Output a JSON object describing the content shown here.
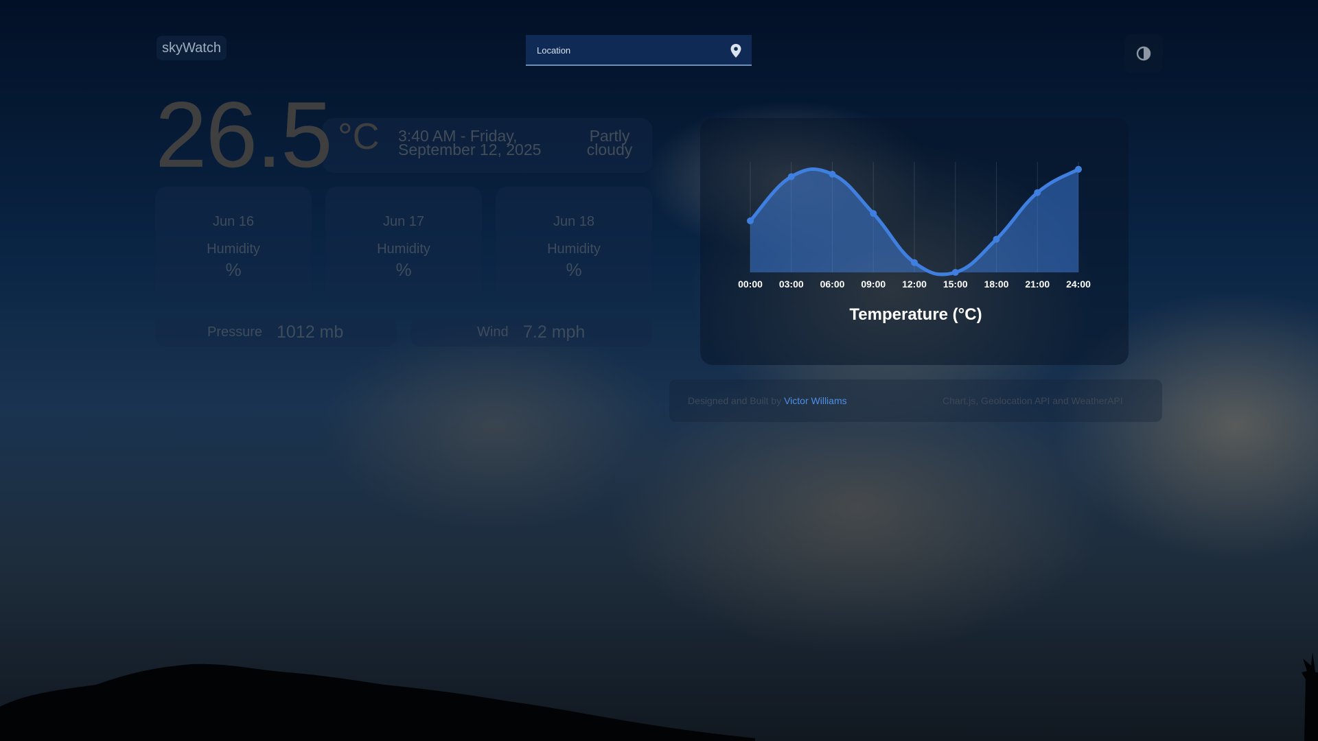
{
  "app": {
    "brand": "skyWatch"
  },
  "search": {
    "placeholder": "Location"
  },
  "current": {
    "temperature": "26.5",
    "unit": "°C",
    "time_line1": "3:40 AM - Friday,",
    "time_line2": "September 12, 2025",
    "condition_line1": "Partly",
    "condition_line2": "cloudy"
  },
  "forecast": [
    {
      "date": "Jun 16",
      "humidity_label": "Humidity",
      "humidity_value": "%"
    },
    {
      "date": "Jun 17",
      "humidity_label": "Humidity",
      "humidity_value": "%"
    },
    {
      "date": "Jun 18",
      "humidity_label": "Humidity",
      "humidity_value": "%"
    }
  ],
  "stats": {
    "pressure_label": "Pressure",
    "pressure_value": "1012 mb",
    "wind_label": "Wind",
    "wind_value": "7.2 mph"
  },
  "chart_data": {
    "type": "area",
    "title": "Temperature (°C)",
    "xlabel": "",
    "ylabel": "",
    "x": [
      "00:00",
      "03:00",
      "06:00",
      "09:00",
      "12:00",
      "15:00",
      "18:00",
      "21:00",
      "24:00"
    ],
    "series": [
      {
        "values": [
          21.2,
          24.8,
          25.0,
          21.8,
          17.8,
          17.0,
          19.7,
          23.5,
          25.4
        ]
      }
    ],
    "ylim": [
      17,
      26
    ],
    "grid": "vertical",
    "line_color": "#3f7fe0",
    "fill_color": "#3f7fe0"
  },
  "footer": {
    "designed_by": "Designed and Built by ",
    "author": "Victor Williams",
    "stack": "Chart.js, Geolocation API and WeatherAPI"
  },
  "colors": {
    "accent": "#4e8fe6",
    "search_bg": "#0e2a55"
  },
  "icons": {
    "location": "location-pin-icon",
    "theme": "contrast-toggle-icon"
  }
}
